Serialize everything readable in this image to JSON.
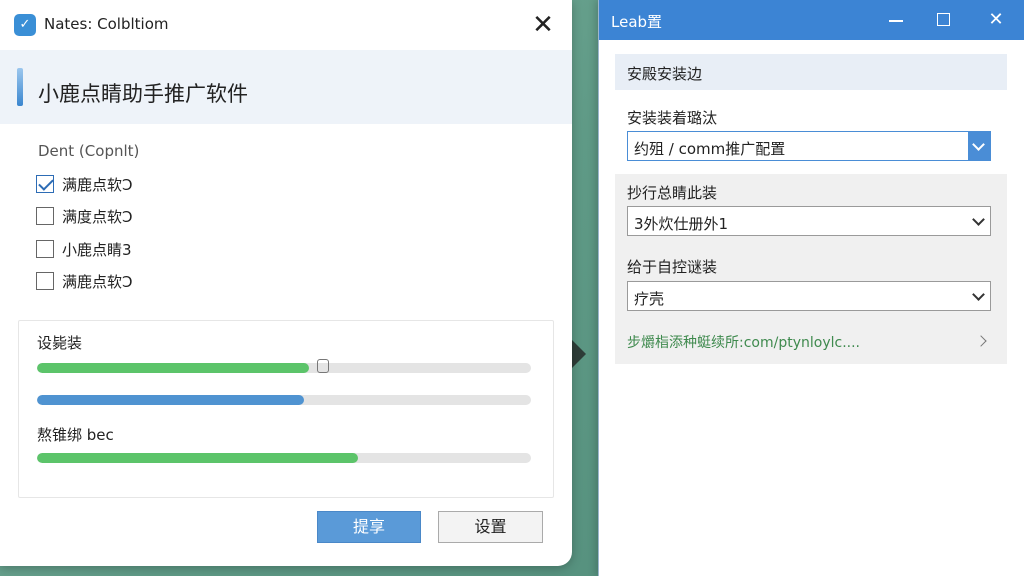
{
  "left_window": {
    "title": "Nates: Colbltiom",
    "heading": "小鹿点睛助手推广软件",
    "group_label": "Dent (Copnlt)",
    "options": [
      {
        "label": "满鹿点软Ɔ",
        "checked": true
      },
      {
        "label": "满度点软Ɔ",
        "checked": false
      },
      {
        "label": "小鹿点睛3",
        "checked": false
      },
      {
        "label": "满鹿点软Ɔ",
        "checked": false
      }
    ],
    "progress": [
      {
        "label": "设毙装",
        "value": 0.55,
        "color": "green"
      },
      {
        "label": "",
        "value": 0.54,
        "color": "blue"
      },
      {
        "label": "熬锥绑 bec",
        "value": 0.65,
        "color": "green"
      }
    ],
    "buttons": {
      "primary": "提享",
      "secondary": "设置"
    }
  },
  "right_window": {
    "title": "Leab置",
    "section_title": "安殿安装边",
    "fields": [
      {
        "label": "安装装着璐汰",
        "value": "约殂 / comm推广配置"
      },
      {
        "label": "抄行总睛此装",
        "value": "3外炊仕册外1"
      },
      {
        "label": "给于自控谜装",
        "value": "疗壳"
      }
    ],
    "link_text": "步爝栺添种蜓续所:com/ptynloylc....",
    "colors": {
      "titlebar": "#3c84d4",
      "accent": "#4a8dd6",
      "progress_green": "#5cc46a",
      "progress_blue": "#4f93d1"
    }
  }
}
